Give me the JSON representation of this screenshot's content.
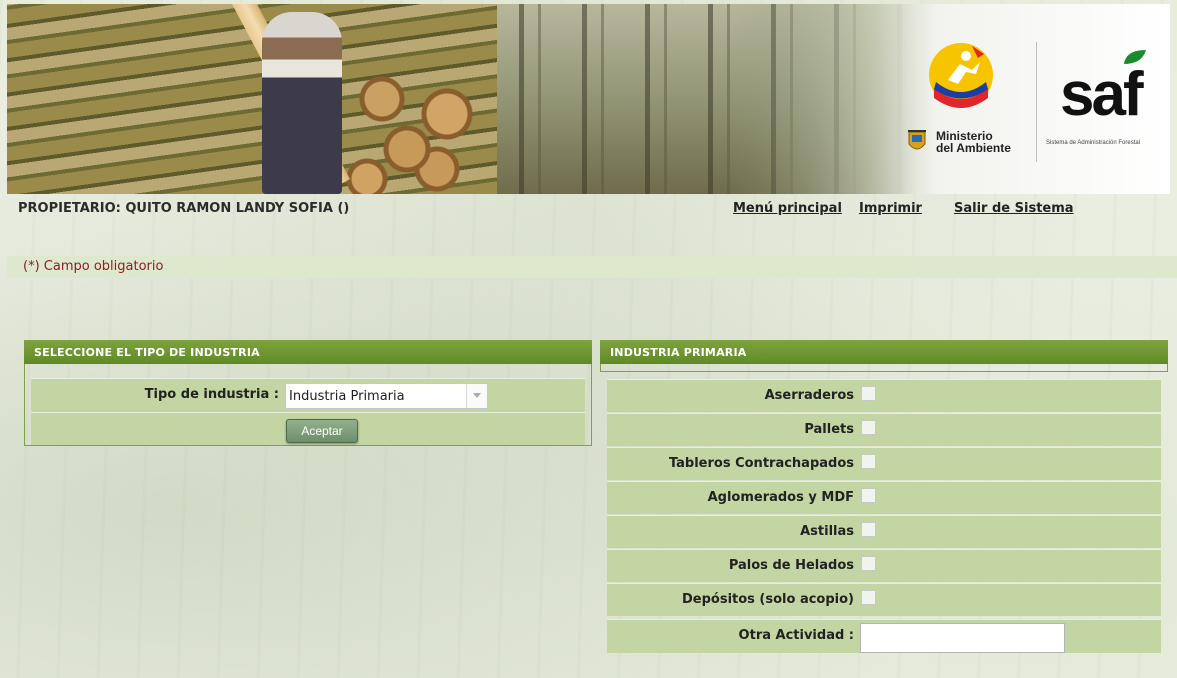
{
  "header": {
    "ministerio_line1": "Ministerio",
    "ministerio_line2": "del Ambiente",
    "saf_logo": "saf",
    "saf_subtitle": "Sistema de Administración Forestal"
  },
  "topbar": {
    "owner": "PROPIETARIO: QUITO RAMON LANDY SOFIA ()",
    "menu_principal": "Menú principal",
    "imprimir": "Imprimir",
    "salir": "Salir de Sistema"
  },
  "required_note": "(*) Campo obligatorio",
  "industry_panel": {
    "title": "SELECCIONE EL TIPO DE INDUSTRIA",
    "label": "Tipo de industria :",
    "selected": "Industria Primaria",
    "button": "Aceptar"
  },
  "primary_panel": {
    "title": "INDUSTRIA PRIMARIA",
    "items": [
      {
        "label": "Aserraderos",
        "checked": false
      },
      {
        "label": "Pallets",
        "checked": false
      },
      {
        "label": "Tableros Contrachapados",
        "checked": false
      },
      {
        "label": "Aglomerados y MDF",
        "checked": false
      },
      {
        "label": "Astillas",
        "checked": false
      },
      {
        "label": "Palos de Helados",
        "checked": false
      },
      {
        "label": "Depósitos (solo acopio)",
        "checked": false
      }
    ],
    "other_label": "Otra Actividad :",
    "other_value": ""
  }
}
